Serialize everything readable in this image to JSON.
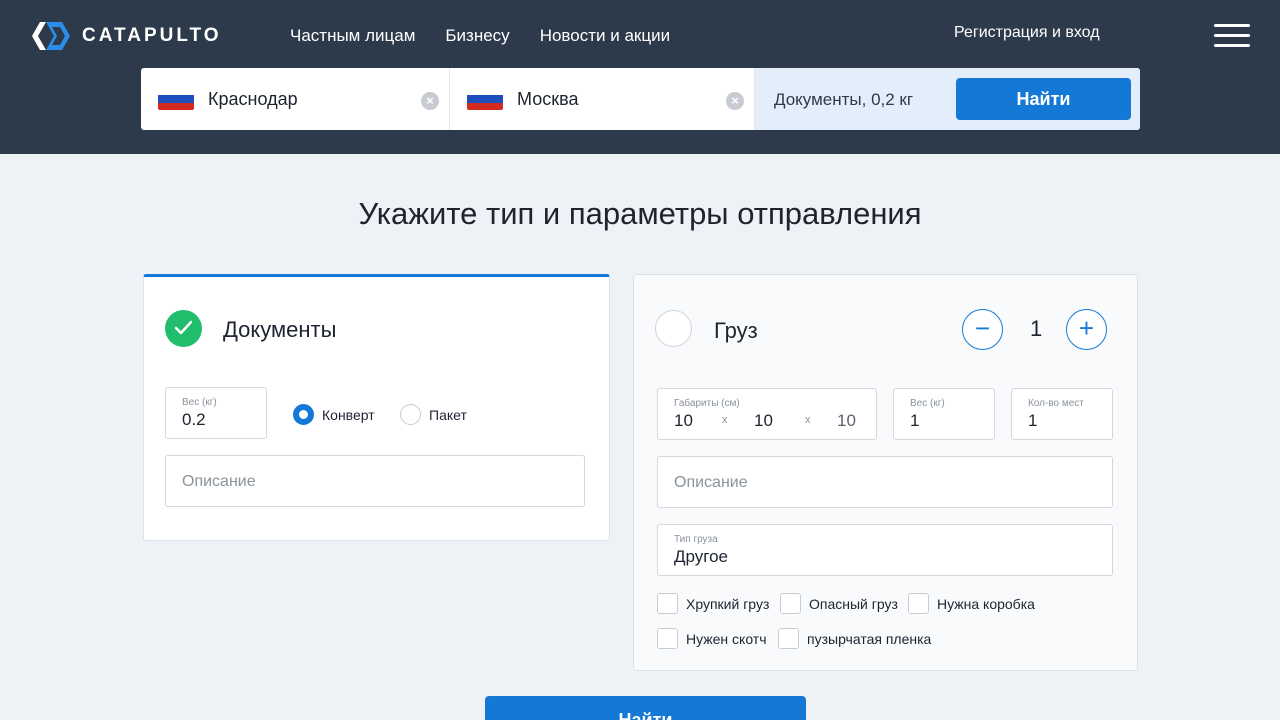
{
  "brand": {
    "name": "CATAPULTO"
  },
  "nav": {
    "items": [
      "Частным лицам",
      "Бизнесу",
      "Новости и акции"
    ]
  },
  "header": {
    "login_label": "Регистрация и вход"
  },
  "search": {
    "from": "Краснодар",
    "to": "Москва",
    "params": "Документы, 0,2 кг",
    "find_label": "Найти"
  },
  "page_title": "Укажите тип и параметры отправления",
  "documents": {
    "label": "Документы",
    "selected": true,
    "weight_label": "Вес (кг)",
    "weight_value": "0.2",
    "radio_options": [
      "Конверт",
      "Пакет"
    ],
    "radio_selected": "Конверт",
    "description_placeholder": "Описание"
  },
  "cargo": {
    "label": "Груз",
    "selected": false,
    "count": "1",
    "dimensions_label": "Габариты (см)",
    "dimensions": [
      "10",
      "10",
      "10"
    ],
    "dim_separator": "x",
    "weight_label": "Вес (кг)",
    "weight_value": "1",
    "places_label": "Кол-во мест",
    "places_value": "1",
    "description_placeholder": "Описание",
    "type_label": "Тип груза",
    "type_value": "Другое",
    "options": [
      "Хрупкий груз",
      "Опасный груз",
      "Нужна коробка",
      "Нужен скотч",
      "пузырчатая пленка"
    ]
  },
  "submit_label": "Найти",
  "colors": {
    "header_bg": "#2d3a4b",
    "accent": "#1479d6",
    "success": "#1fbd6c"
  }
}
